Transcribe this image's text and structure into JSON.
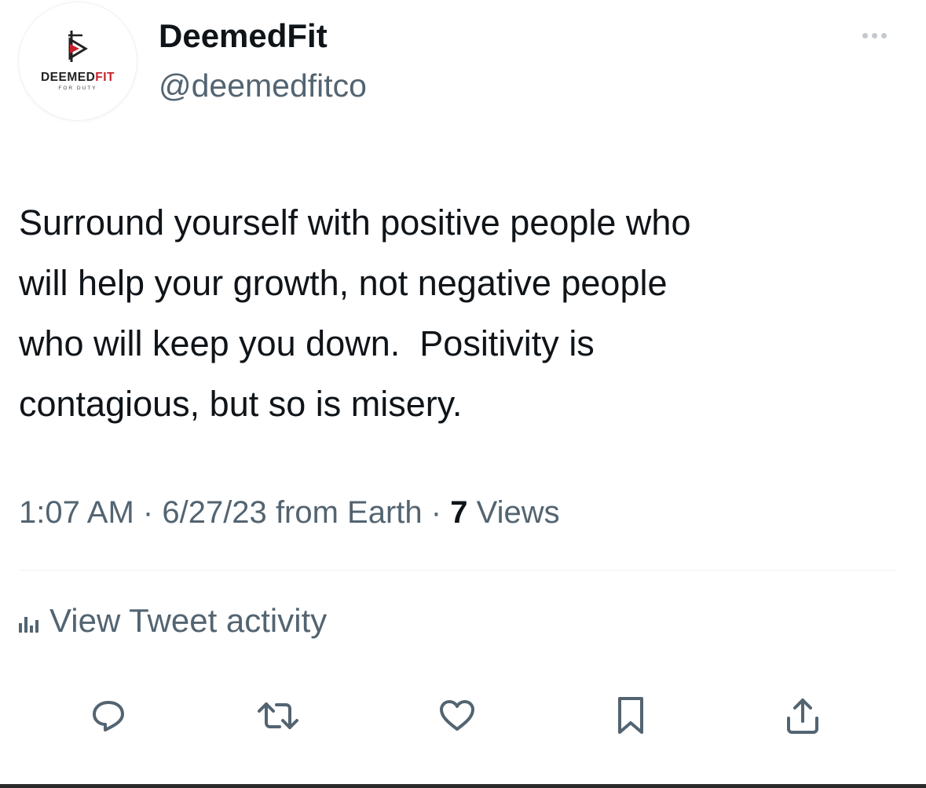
{
  "profile": {
    "display_name": "DeemedFit",
    "handle": "@deemedfitco",
    "avatar_logo": {
      "brand_primary": "DEEMED",
      "brand_accent": "FIT",
      "tagline": "FOR DUTY",
      "accent_color": "#c8202a"
    }
  },
  "tweet": {
    "text": "Surround yourself with positive people who\nwill help your growth, not negative people\nwho will keep you down.  Positivity is\ncontagious, but so is misery."
  },
  "meta": {
    "time": "1:07 AM",
    "separator": "·",
    "date": "6/27/23",
    "source": "from Earth",
    "views_count": "7",
    "views_label": "Views"
  },
  "activity": {
    "label": "View Tweet activity",
    "icon": "bar-chart-icon"
  },
  "actions": [
    {
      "name": "reply",
      "icon": "speech-bubble-icon"
    },
    {
      "name": "retweet",
      "icon": "retweet-icon"
    },
    {
      "name": "like",
      "icon": "heart-icon"
    },
    {
      "name": "bookmark",
      "icon": "bookmark-icon"
    },
    {
      "name": "share",
      "icon": "share-icon"
    }
  ],
  "colors": {
    "text_primary": "#0f1419",
    "text_secondary": "#536471",
    "action_icon": "#536471",
    "divider": "#eff3f4"
  }
}
